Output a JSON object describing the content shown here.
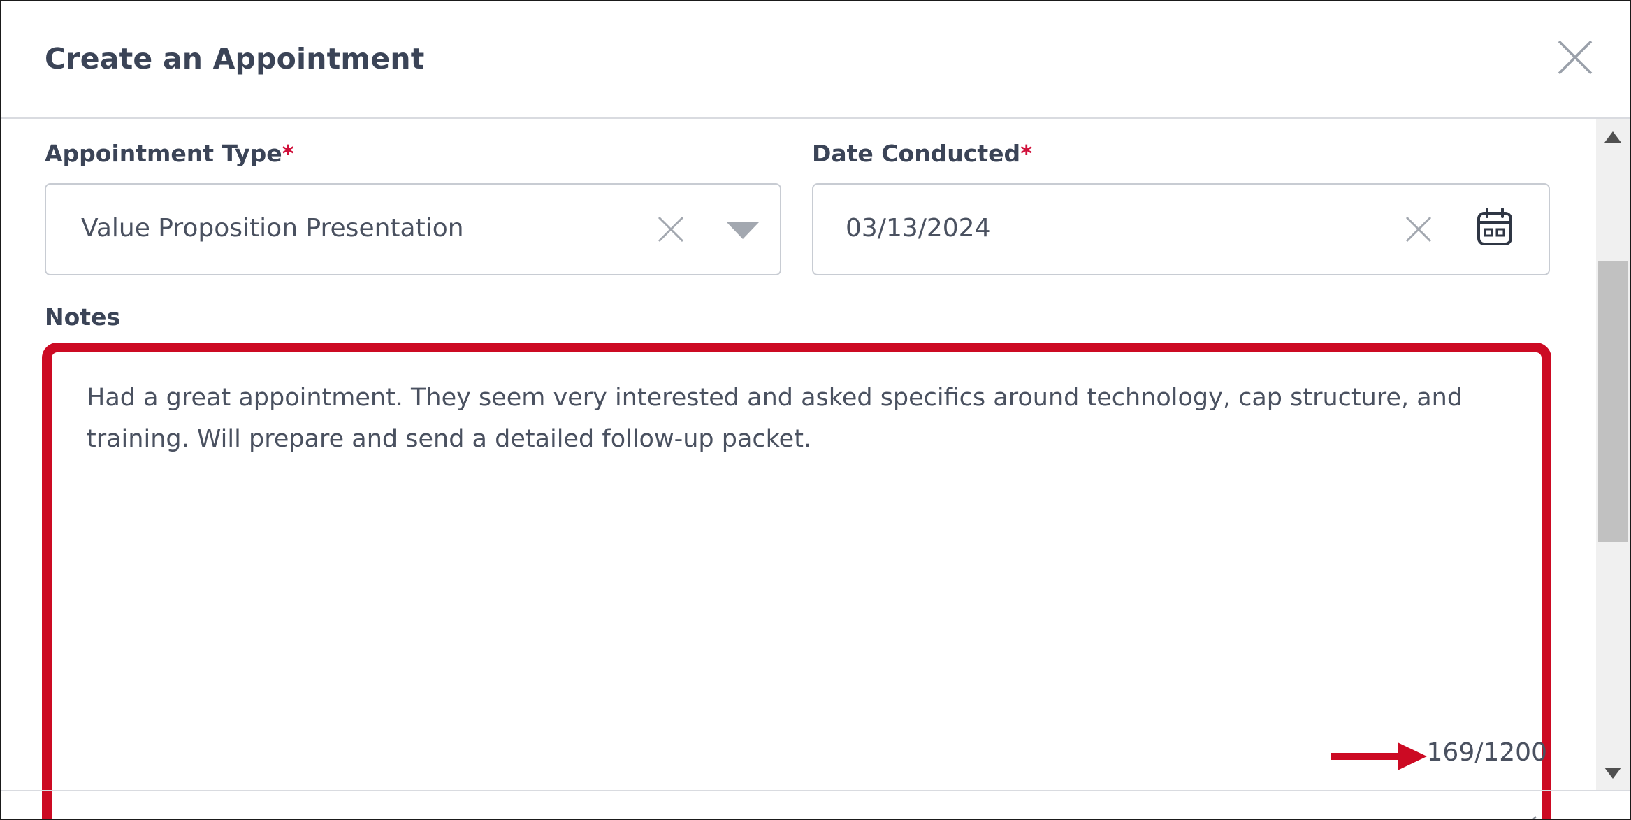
{
  "dialog": {
    "title": "Create an Appointment"
  },
  "appointment_type": {
    "label": "Appointment Type",
    "required_mark": "*",
    "value": "Value Proposition Presentation"
  },
  "date_conducted": {
    "label": "Date Conducted",
    "required_mark": "*",
    "value": "03/13/2024"
  },
  "notes": {
    "label": "Notes",
    "value": "Had a great appointment. They seem very interested and asked specifics around technology, cap structure, and training. Will prepare and send a detailed follow-up packet.",
    "counter": "169/1200"
  },
  "colors": {
    "highlight": "#cc0a23",
    "required": "#d0103a",
    "text": "#3b4457"
  },
  "icons": [
    "close-icon",
    "clear-icon",
    "dropdown-arrow-icon",
    "calendar-icon",
    "resize-handle-icon",
    "annotation-arrow-icon",
    "scroll-up-icon",
    "scroll-down-icon"
  ]
}
